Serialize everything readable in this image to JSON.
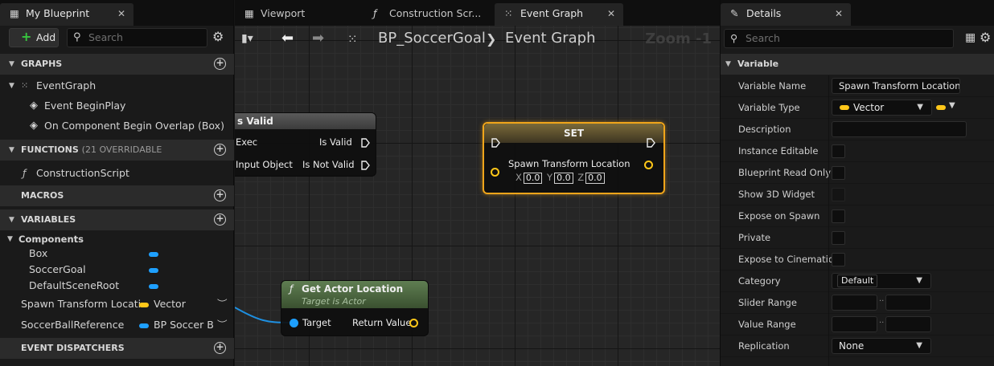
{
  "left_panel": {
    "tab_title": "My Blueprint",
    "add_label": "Add",
    "search_placeholder": "Search",
    "sections": {
      "graphs": "GRAPHS",
      "functions": "FUNCTIONS",
      "functions_sub": "(21 OVERRIDABLE",
      "macros": "MACROS",
      "variables": "VARIABLES",
      "dispatchers": "EVENT DISPATCHERS"
    },
    "graph_items": {
      "event_graph": "EventGraph",
      "begin_play": "Event BeginPlay",
      "overlap": "On Component Begin Overlap (Box)"
    },
    "function_items": {
      "construction": "ConstructionScript"
    },
    "components_label": "Components",
    "components": [
      "Box",
      "SoccerGoal",
      "DefaultSceneRoot"
    ],
    "variables": [
      {
        "name": "Spawn Transform Locati",
        "type": "Vector",
        "color": "#ffc719"
      },
      {
        "name": "SoccerBallReference",
        "type": "BP Soccer B",
        "color": "#1ea0ff"
      }
    ]
  },
  "center": {
    "tabs": [
      "Viewport",
      "Construction Scr...",
      "Event Graph"
    ],
    "breadcrumb_bp": "BP_SoccerGoal",
    "breadcrumb_graph": "Event Graph",
    "zoom": "Zoom -1",
    "is_valid_node": {
      "title": "s Valid",
      "exec_in": "Exec",
      "input_object": "Input Object",
      "is_valid": "Is Valid",
      "is_not_valid": "Is Not Valid"
    },
    "set_node": {
      "title": "SET",
      "pin": "Spawn Transform Location",
      "x_label": "X",
      "x": "0.0",
      "y_label": "Y",
      "y": "0.0",
      "z_label": "Z",
      "z": "0.0"
    },
    "get_actor_node": {
      "title": "Get Actor Location",
      "subtitle": "Target is Actor",
      "target": "Target",
      "return": "Return Value"
    }
  },
  "details": {
    "tab_title": "Details",
    "search_placeholder": "Search",
    "section": "Variable",
    "rows": {
      "variable_name": "Variable Name",
      "variable_name_value": "Spawn Transform Location",
      "variable_type": "Variable Type",
      "variable_type_value": "Vector",
      "description": "Description",
      "instance_editable": "Instance Editable",
      "bp_read_only": "Blueprint Read Only",
      "show_3d_widget": "Show 3D Widget",
      "expose_on_spawn": "Expose on Spawn",
      "private": "Private",
      "expose_cinematic": "Expose to Cinematic",
      "category": "Category",
      "category_value": "Default",
      "slider_range": "Slider Range",
      "value_range": "Value Range",
      "replication": "Replication",
      "replication_value": "None"
    }
  },
  "colors": {
    "vector": "#ffc719",
    "object": "#1ea0ff",
    "set_border": "#f0a51a",
    "func_header": "#4b6a3f"
  }
}
